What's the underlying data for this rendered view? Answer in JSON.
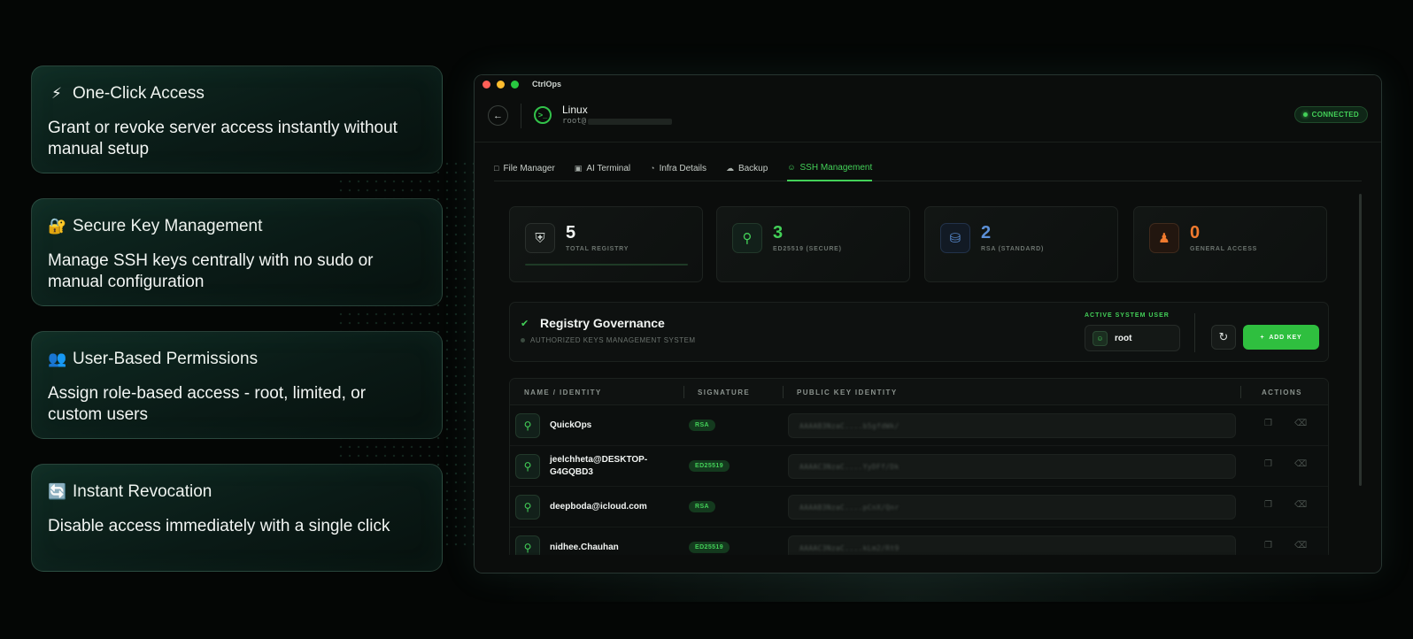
{
  "features": [
    {
      "emoji": "⚡",
      "title": "One-Click Access",
      "desc": "Grant or revoke server access instantly without manual setup"
    },
    {
      "emoji": "🔐",
      "title": "Secure Key Management",
      "desc": "Manage SSH keys centrally with no sudo or manual configuration"
    },
    {
      "emoji": "👥",
      "title": "User-Based Permissions",
      "desc": "Assign role-based access - root, limited, or custom users"
    },
    {
      "emoji": "🔄",
      "title": "Instant Revocation",
      "desc": "Disable access immediately with a single click"
    }
  ],
  "window": {
    "app_name": "CtrlOps",
    "server_name": "Linux",
    "server_user": "root@",
    "status": "CONNECTED"
  },
  "tabs": [
    {
      "label": "File Manager",
      "icon": "folder-icon"
    },
    {
      "label": "AI Terminal",
      "icon": "terminal-icon"
    },
    {
      "label": "Infra Details",
      "icon": "gauge-icon"
    },
    {
      "label": "Backup",
      "icon": "cloud-icon"
    },
    {
      "label": "SSH Management",
      "icon": "user-icon",
      "active": true
    }
  ],
  "stats": [
    {
      "value": "5",
      "label": "TOTAL REGISTRY",
      "color": "#f2f5f3",
      "icon": "shield-icon"
    },
    {
      "value": "3",
      "label": "ED25519 (SECURE)",
      "color": "#43d058",
      "icon": "search-key-icon"
    },
    {
      "value": "2",
      "label": "RSA (STANDARD)",
      "color": "#5b8fd6",
      "icon": "lock-icon"
    },
    {
      "value": "0",
      "label": "GENERAL ACCESS",
      "color": "#f07a2e",
      "icon": "person-icon"
    }
  ],
  "governance": {
    "title": "Registry Governance",
    "subtitle": "AUTHORIZED KEYS MANAGEMENT SYSTEM",
    "active_user_label": "ACTIVE SYSTEM USER",
    "active_user": "root",
    "add_key_label": "ADD KEY"
  },
  "table": {
    "headers": {
      "name": "NAME / IDENTITY",
      "signature": "SIGNATURE",
      "public_key": "PUBLIC KEY IDENTITY",
      "actions": "ACTIONS"
    },
    "rows": [
      {
        "name": "QuickOps",
        "signature": "RSA",
        "key": "AAAAB3NzaC....b5gfdWk/"
      },
      {
        "name": "jeelchheta@DESKTOP-G4GQBD3",
        "signature": "ED25519",
        "key": "AAAAC3NzaC....YyDFf/Dk"
      },
      {
        "name": "deepboda@icloud.com",
        "signature": "RSA",
        "key": "AAAAB3NzaC....pCnX/Qnr"
      },
      {
        "name": "nidhee.Chauhan",
        "signature": "ED25519",
        "key": "AAAAC3NzaC....kLm2/Rt9"
      }
    ]
  },
  "colors": {
    "accent": "#43d058",
    "rsa_blue": "#5b8fd6",
    "general_orange": "#f07a2e"
  }
}
